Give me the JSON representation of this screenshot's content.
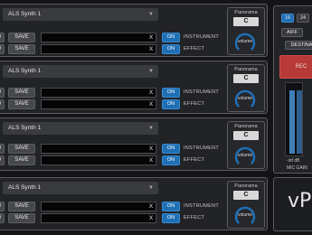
{
  "tracks": [
    {
      "synth": "ALS Synth 1",
      "load_label": "D",
      "save_label": "SAVE",
      "x_label": "X",
      "on_label": "ON",
      "row1_label": "INSTRUMENT",
      "row2_label": "EFFECT",
      "pan_label": "Panorama",
      "pan_value": "C",
      "volume_label": "volume"
    },
    {
      "synth": "ALS Synth 1",
      "load_label": "D",
      "save_label": "SAVE",
      "x_label": "X",
      "on_label": "ON",
      "row1_label": "INSTRUMENT",
      "row2_label": "EFFECT",
      "pan_label": "Panorama",
      "pan_value": "C",
      "volume_label": "volume"
    },
    {
      "synth": "ALS Synth 1",
      "load_label": "D",
      "save_label": "SAVE",
      "x_label": "X",
      "on_label": "ON",
      "row1_label": "INSTRUMENT",
      "row2_label": "EFFECT",
      "pan_label": "Panorama",
      "pan_value": "C",
      "volume_label": "volume"
    },
    {
      "synth": "ALS Synth 1",
      "load_label": "D",
      "save_label": "SAVE",
      "x_label": "X",
      "on_label": "ON",
      "row1_label": "INSTRUMENT",
      "row2_label": "EFFECT",
      "pan_label": "Panorama",
      "pan_value": "C",
      "volume_label": "volume"
    }
  ],
  "recorder": {
    "bit16": "16",
    "bit24": "24",
    "format": "AIFF",
    "destination": "DESTINAT",
    "rec": "REC",
    "inf_db": "-inf dB",
    "mic_gain": "MIC GAIN"
  },
  "brand": "vP",
  "colors": {
    "accent": "#1f6fb5",
    "rec": "#b73a38",
    "meter": "#3f7fb8",
    "panel": "#222326"
  }
}
